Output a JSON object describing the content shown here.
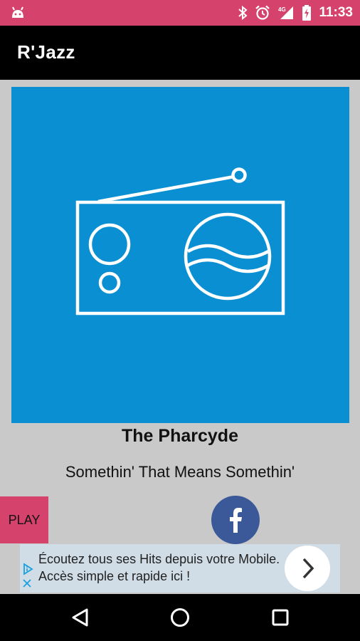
{
  "status_bar": {
    "time": "11:33",
    "icons": [
      "android-icon",
      "bluetooth-icon",
      "alarm-icon",
      "signal-4g-icon",
      "battery-charging-icon"
    ]
  },
  "app_bar": {
    "title": "R'Jazz"
  },
  "artwork": {
    "icon": "radio-icon",
    "background": "#0b8fd3"
  },
  "now_playing": {
    "artist": "The Pharcyde",
    "song": "Somethin' That Means Somethin'"
  },
  "controls": {
    "play_label": "PLAY",
    "share_icon": "facebook-icon"
  },
  "ad": {
    "text": "Écoutez tous ses Hits depuis votre Mobile. Accès simple et rapide ici !",
    "info_icon": "ad-choices-icon",
    "close_icon": "close-icon",
    "arrow_icon": "chevron-right-icon"
  },
  "nav_bar": {
    "icons": [
      "back-icon",
      "home-icon",
      "recents-icon"
    ]
  },
  "colors": {
    "accent": "#d5426b",
    "artwork_blue": "#0b8fd3",
    "facebook_blue": "#3b5998",
    "background": "#c9c9c9"
  }
}
